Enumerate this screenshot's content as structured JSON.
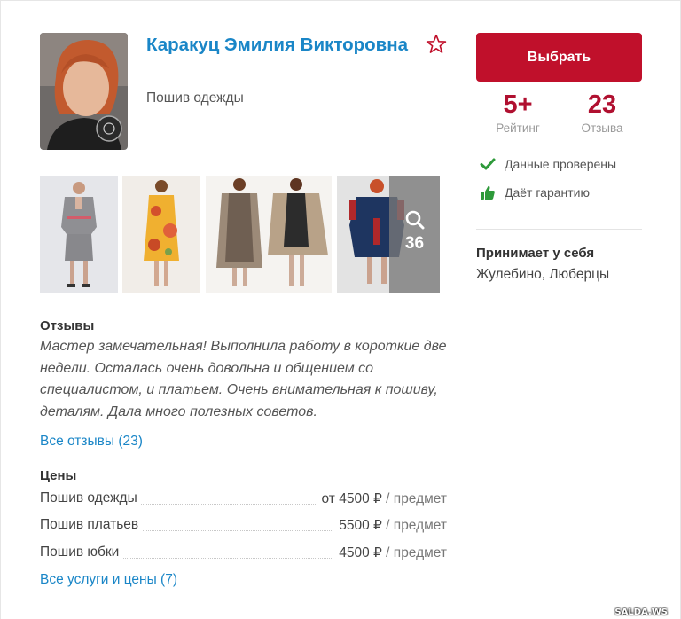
{
  "profile": {
    "name": "Каракуц Эмилия Викторовна",
    "service": "Пошив одежды"
  },
  "actions": {
    "choose_label": "Выбрать"
  },
  "stats": {
    "rating_value": "5+",
    "rating_label": "Рейтинг",
    "reviews_value": "23",
    "reviews_label": "Отзыва"
  },
  "badges": {
    "verified": "Данные проверены",
    "guarantee": "Даёт гарантию"
  },
  "location": {
    "title": "Принимает у себя",
    "areas": "Жулебино, Люберцы"
  },
  "gallery": {
    "more_count": "36"
  },
  "reviews": {
    "title": "Отзывы",
    "text": "Мастер замечательная! Выполнила работу в короткие две недели. Осталась очень довольна и общением со специалистом, и платьем. Очень внимательная к пошиву, деталям. Дала много полезных советов.",
    "all_link": "Все отзывы (23)"
  },
  "prices": {
    "title": "Цены",
    "items": [
      {
        "name": "Пошив одежды",
        "value": "от 4500 ₽",
        "unit": " / предмет"
      },
      {
        "name": "Пошив платьев",
        "value": "5500 ₽",
        "unit": " / предмет"
      },
      {
        "name": "Пошив юбки",
        "value": "4500 ₽",
        "unit": " / предмет"
      }
    ],
    "all_link": "Все услуги и цены (7)"
  },
  "watermark": "SALDA.WS",
  "colors": {
    "accent_red": "#c0102b",
    "link_blue": "#1a86c7",
    "check_green": "#2e9a3a"
  }
}
